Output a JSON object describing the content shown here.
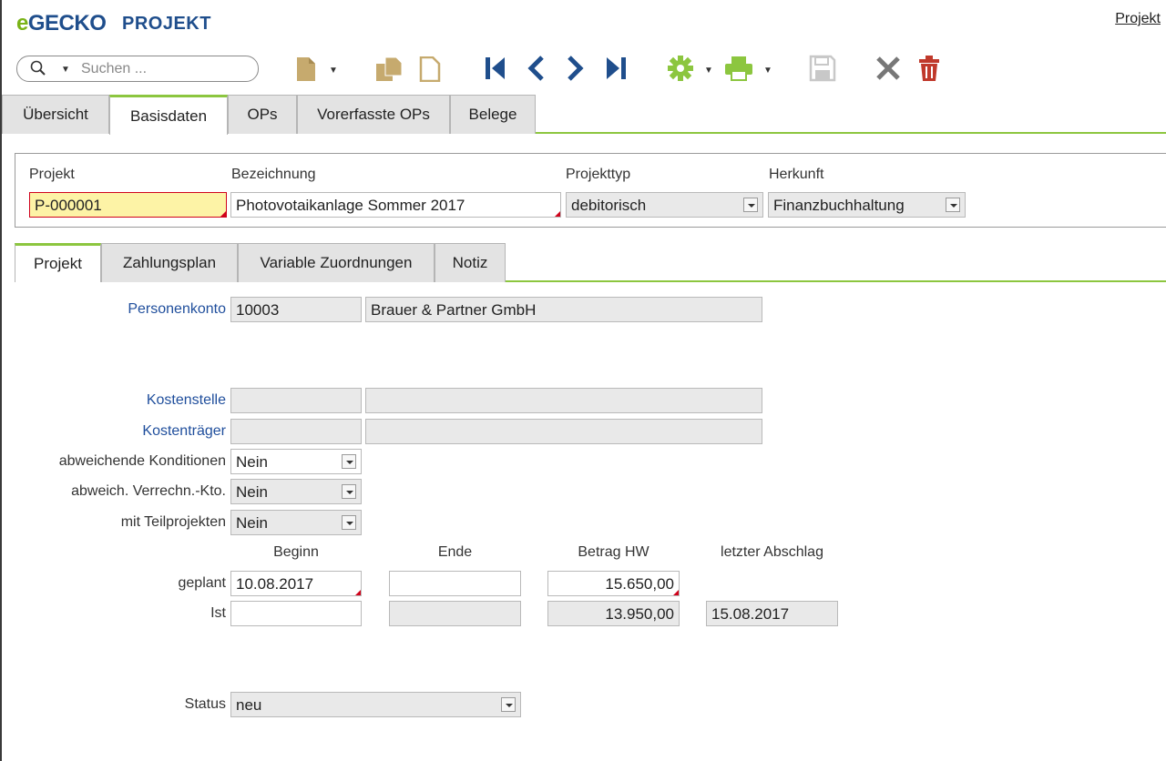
{
  "app": {
    "logo_e": "e",
    "logo_rest": "GECKO",
    "module_title": "PROJEKT",
    "top_right_link": "Projekt"
  },
  "search": {
    "placeholder": "Suchen ..."
  },
  "toolbar": {
    "icons": [
      "new-document-icon",
      "copy-icon",
      "paste-icon",
      "first-record-icon",
      "previous-record-icon",
      "next-record-icon",
      "last-record-icon",
      "settings-gear-icon",
      "print-icon",
      "save-icon",
      "cancel-icon",
      "delete-trash-icon"
    ],
    "accent_green": "#8cc63f",
    "nav_blue": "#1f4e8c",
    "delete_red": "#c0392b"
  },
  "main_tabs": [
    {
      "label": "Übersicht",
      "active": false
    },
    {
      "label": "Basisdaten",
      "active": true
    },
    {
      "label": "OPs",
      "active": false
    },
    {
      "label": "Vorerfasste OPs",
      "active": false
    },
    {
      "label": "Belege",
      "active": false
    }
  ],
  "header": {
    "projekt_label": "Projekt",
    "projekt_value": "P-000001",
    "bezeichnung_label": "Bezeichnung",
    "bezeichnung_value": "Photovotaikanlage Sommer 2017",
    "projekttyp_label": "Projekttyp",
    "projekttyp_value": "debitorisch",
    "herkunft_label": "Herkunft",
    "herkunft_value": "Finanzbuchhaltung"
  },
  "sub_tabs": [
    {
      "label": "Projekt",
      "active": true
    },
    {
      "label": "Zahlungsplan",
      "active": false
    },
    {
      "label": "Variable Zuordnungen",
      "active": false
    },
    {
      "label": "Notiz",
      "active": false
    }
  ],
  "form": {
    "personenkonto_label": "Personenkonto",
    "personenkonto_nr": "10003",
    "personenkonto_name": "Brauer & Partner GmbH",
    "kostenstelle_label": "Kostenstelle",
    "kostenstelle_nr": "",
    "kostenstelle_name": "",
    "kostentraeger_label": "Kostenträger",
    "kostentraeger_nr": "",
    "kostentraeger_name": "",
    "abw_konditionen_label": "abweichende Konditionen",
    "abw_konditionen_value": "Nein",
    "abw_verrechn_label": "abweich. Verrechn.-Kto.",
    "abw_verrechn_value": "Nein",
    "teilprojekte_label": "mit Teilprojekten",
    "teilprojekte_value": "Nein",
    "col_beginn": "Beginn",
    "col_ende": "Ende",
    "col_betrag": "Betrag HW",
    "col_abschlag": "letzter Abschlag",
    "geplant_label": "geplant",
    "geplant_beginn": "10.08.2017",
    "geplant_ende": "",
    "geplant_betrag": "15.650,00",
    "ist_label": "Ist",
    "ist_beginn": "",
    "ist_ende": "",
    "ist_betrag": "13.950,00",
    "ist_abschlag": "15.08.2017",
    "status_label": "Status",
    "status_value": "neu"
  }
}
